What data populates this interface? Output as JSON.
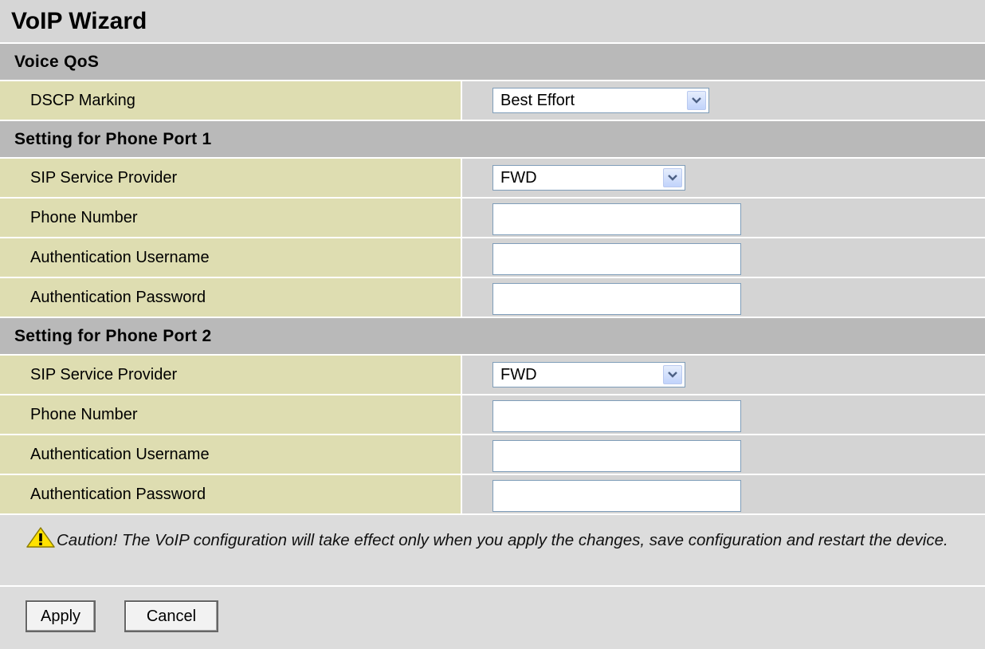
{
  "page": {
    "title": "VoIP Wizard"
  },
  "voice_qos": {
    "heading": "Voice QoS",
    "dscp_label": "DSCP Marking",
    "dscp_value": "Best Effort"
  },
  "port1": {
    "heading": "Setting for Phone Port 1",
    "provider_label": "SIP Service Provider",
    "provider_value": "FWD",
    "phone_label": "Phone Number",
    "phone_value": "",
    "user_label": "Authentication Username",
    "user_value": "",
    "pass_label": "Authentication Password",
    "pass_value": ""
  },
  "port2": {
    "heading": "Setting for Phone Port 2",
    "provider_label": "SIP Service Provider",
    "provider_value": "FWD",
    "phone_label": "Phone Number",
    "phone_value": "",
    "user_label": "Authentication Username",
    "user_value": "",
    "pass_label": "Authentication Password",
    "pass_value": ""
  },
  "caution": {
    "icon": "warning-icon",
    "text": "Caution! The VoIP configuration will take effect only when you apply the changes, save configuration and restart the device."
  },
  "buttons": {
    "apply": "Apply",
    "cancel": "Cancel"
  },
  "colors": {
    "label_bg": "#deddb1",
    "section_bg": "#b9b9b9",
    "panel_bg": "#d4d4d4",
    "warning_yellow": "#ffe200"
  }
}
